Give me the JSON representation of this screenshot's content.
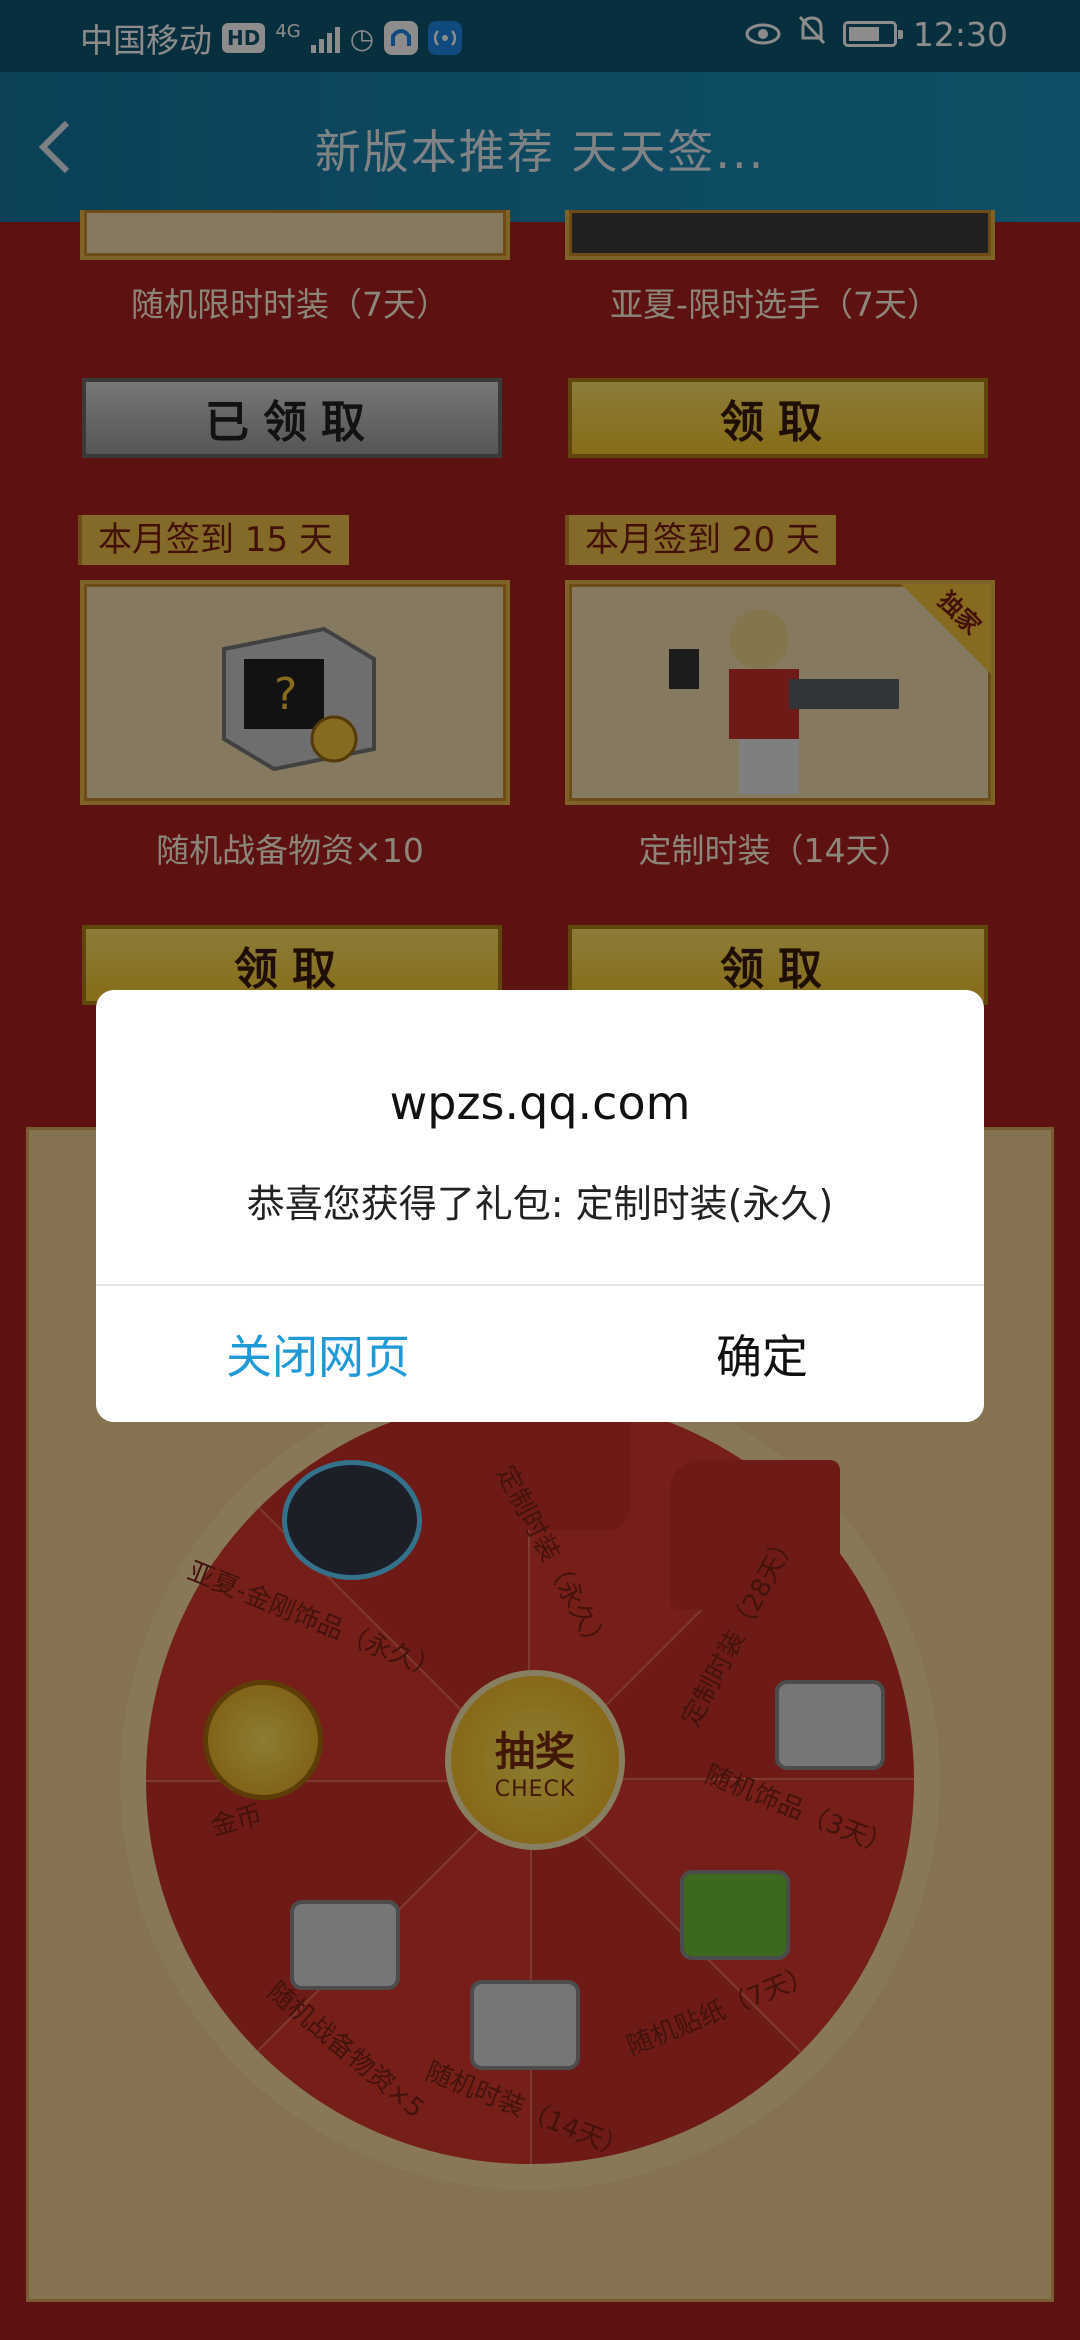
{
  "status_bar": {
    "carrier": "中国移动",
    "hd": "HD",
    "network": "4G",
    "time": "12:30"
  },
  "title_bar": {
    "title": "新版本推荐 天天签..."
  },
  "rewards": {
    "row1": [
      {
        "label": "随机限时时装（7天）",
        "button": "已领取"
      },
      {
        "label": "亚夏-限时选手（7天）",
        "button": "领取"
      }
    ],
    "row2": [
      {
        "tag": "本月签到 15 天",
        "label": "随机战备物资×10",
        "button": "领取"
      },
      {
        "tag": "本月签到 20 天",
        "label": "定制时装（14天）",
        "button": "领取",
        "badge": "独家"
      }
    ]
  },
  "wheel": {
    "center_main": "抽奖",
    "center_sub": "CHECK",
    "prizes": [
      "亚夏-金刚饰品（永久）",
      "定制时装（永久）",
      "定制时装（28天）",
      "随机饰品（3天）",
      "随机贴纸（7天）",
      "随机时装（14天）",
      "随机战备物资×5",
      "金币"
    ]
  },
  "dialog": {
    "title": "wpzs.qq.com",
    "message": "恭喜您获得了礼包: 定制时装(永久)",
    "close_label": "关闭网页",
    "ok_label": "确定"
  },
  "colors": {
    "page_red": "#ab2020",
    "title_bar": "#1b93bd",
    "gold_button": "#f3c52a",
    "link_blue": "#1f9ad6"
  }
}
